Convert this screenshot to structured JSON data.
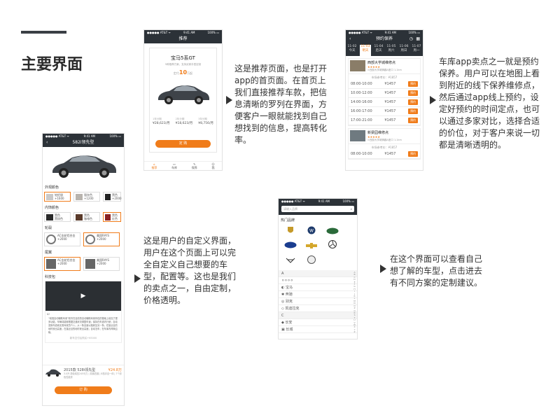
{
  "heading": "主要界面",
  "status": {
    "carrier": "●●●●● AT&T ᯤ",
    "time": "9:41 AM",
    "battery": "100% ▭"
  },
  "rec": {
    "nav": "推荐",
    "car": "宝马5系GT",
    "car_sub": "5种推荐方案，支持买家手型定制",
    "price_pre": "定付",
    "price_num": "10",
    "price_suf": "万起",
    "cols": [
      {
        "l": "1年分期",
        "v": "¥28,623/月"
      },
      {
        "l": "2年分期",
        "v": "¥18,623/月"
      },
      {
        "l": "3年分期",
        "v": "¥8,756/月"
      }
    ],
    "btn": "定 购",
    "tabs": [
      "推荐",
      "车库",
      "保养",
      "我"
    ]
  },
  "rec_desc": "这是推荐页面，也是打开app的首页面。在首页上我们直接推荐车款，把信息清晰的罗列在界面，方便客户一眼就能找到自己想找到的信息，提高转化率。",
  "maint": {
    "nav": "预约保养",
    "dates": [
      {
        "d": "11-02",
        "w": "今天"
      },
      {
        "d": "11-03",
        "w": "明天"
      },
      {
        "d": "11-04",
        "w": "后天"
      },
      {
        "d": "11-05",
        "w": "周六"
      },
      {
        "d": "11-06",
        "w": "周日"
      },
      {
        "d": "11-07",
        "w": "周一"
      }
    ],
    "shop1": "西部大学城维修点",
    "addr1": "西部大学城情趣A座口",
    "dist1": "1.1km",
    "ref": "市场参考价：¥1857",
    "slots": [
      {
        "t": "08:00-10:00",
        "p": "¥1457",
        "b": "预约"
      },
      {
        "t": "10:00-12:00",
        "p": "¥1457",
        "b": "预约"
      },
      {
        "t": "14:00-16:00",
        "p": "¥1457",
        "b": "预约"
      },
      {
        "t": "16:00-17:00",
        "p": "¥1457",
        "b": "预约"
      },
      {
        "t": "17:00-21:00",
        "p": "¥1457",
        "b": "预约"
      }
    ],
    "shop2": "新梁园维修点",
    "addr2": "西部大学城情趣A座口",
    "dist2": "1.1km",
    "ref2": "市场参考价：¥1857",
    "slot2": {
      "t": "08:00-10:00",
      "p": "¥1457",
      "b": "预约"
    }
  },
  "maint_desc": "车库app卖点之一就是预约保养。用户可以在地图上看到附近的线下保养维修点，然后通过app线上预约，设定好预约的时间定点，也可以通过多家对比，选择合适的价位，对于客户来说一切都是清晰透明的。",
  "custom": {
    "nav": "582i领先型",
    "sec_ext": "外观颜色",
    "ext": [
      {
        "n": "铂铝银",
        "p": "+1600",
        "c": "#c9c9c9",
        "sel": true
      },
      {
        "n": "银灰色",
        "p": "+1200",
        "c": "#b8b4ae"
      },
      {
        "n": "黑色",
        "p": "+2000",
        "c": "#222"
      }
    ],
    "sec_int": "内饰颜色",
    "int": [
      {
        "n": "黑色",
        "n2": "黑纹色",
        "c": "#2a2a2a"
      },
      {
        "n": "黑色",
        "n2": "咖啡色",
        "c": "#5a3a2a"
      },
      {
        "n": "黑色",
        "n2": "红色",
        "c": "#8a2222",
        "sel": true
      }
    ],
    "sec_wheel": "轮毂",
    "wheels": [
      {
        "n": "AC金轮铝合金",
        "p": "+2000"
      },
      {
        "n": "美国RAYS",
        "p": "+2000",
        "sel": true
      }
    ],
    "sec_tail": "尾翼",
    "tails": [
      {
        "n": "AC金轮铝合金",
        "p": "+2000",
        "sel": true
      },
      {
        "n": "美国RAYS",
        "p": "+2000"
      }
    ],
    "sec_tech": "科技包",
    "tech_text": "“增强自动辅助驾驶”软件在目前的自动辅助驾驶伴侣的基础上增加了更多功能，车辆将能够根据交通状况调整车速；保持在车道内行驶；自动变换车道而无需驾驶员介入；从一条高速公路驶至另一条；在接近目的地时驶出高速；在接近目的地时驶出高速；自动泊车；在车库内呼唤召唤。",
    "tech_price": "新车交付后购买+¥5000",
    "car": "2015款 528i领先型",
    "price": "¥24.8万",
    "spec": "3.0升 涡轮增压245马力 | 前置四驱 | 8档手自一体 | 7个彩色性能漆",
    "btn": "订 购"
  },
  "custom_desc": "这是用户的自定义界面，用户在这个页面上可以完全自定义自己想要的车型，配置等。这也是我们的卖点之一，自由定制，价格透明。",
  "brands": {
    "search": "请输入品牌",
    "sec": "热门品牌",
    "letters": [
      "A",
      "B",
      "C",
      "D",
      "E",
      "F",
      "G",
      "H",
      "I",
      "J",
      "K",
      "L",
      "M",
      "N",
      "O",
      "P",
      "Q",
      "R",
      "S",
      "T",
      "U",
      "V",
      "W",
      "X",
      "Y",
      "Z"
    ],
    "list": [
      {
        "h": "A",
        "n": ""
      },
      {
        "h": "",
        "n": "宝马"
      },
      {
        "h": "",
        "n": "奔驰"
      },
      {
        "h": "",
        "n": "别克"
      },
      {
        "h": "",
        "n": "凯迪拉克"
      },
      {
        "h": "C",
        "n": ""
      },
      {
        "h": "",
        "n": "长安"
      },
      {
        "h": "",
        "n": "长城"
      }
    ]
  },
  "brands_desc": "在这个界面可以查看自己想了解的车型，点击进去有不同方案的定制建议。"
}
